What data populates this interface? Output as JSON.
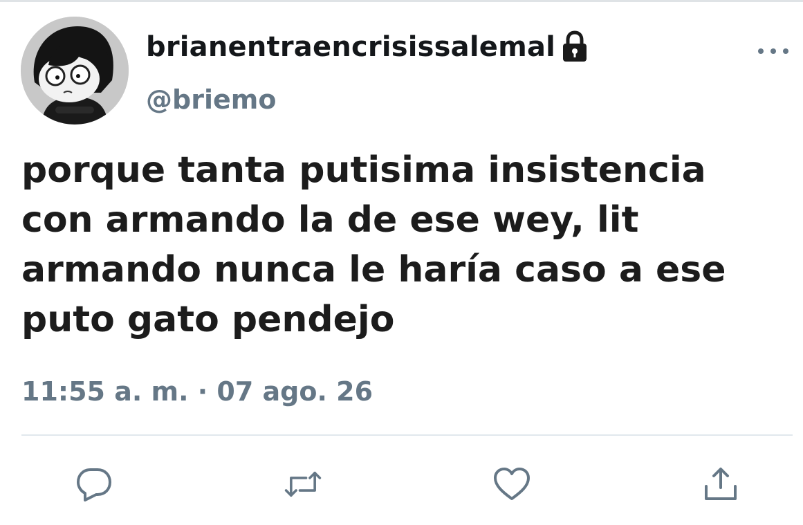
{
  "tweet": {
    "display_name": "brianentraencrisissalemal",
    "handle": "@briemo",
    "text": "porque tanta putisima insistencia\ncon armando la de ese wey, lit\narmando nunca le haría caso a ese\nputo gato pendejo",
    "timestamp": "11:55 a. m. · 07 ago. 26",
    "locked": true
  },
  "icons": {
    "lock": "lock-icon",
    "more": "more-options-icon",
    "reply": "reply-icon",
    "retweet": "retweet-icon",
    "like": "heart-icon",
    "share": "share-icon"
  },
  "colors": {
    "text": "#14171a",
    "secondary": "#657786",
    "divider": "#e1e8ed"
  }
}
